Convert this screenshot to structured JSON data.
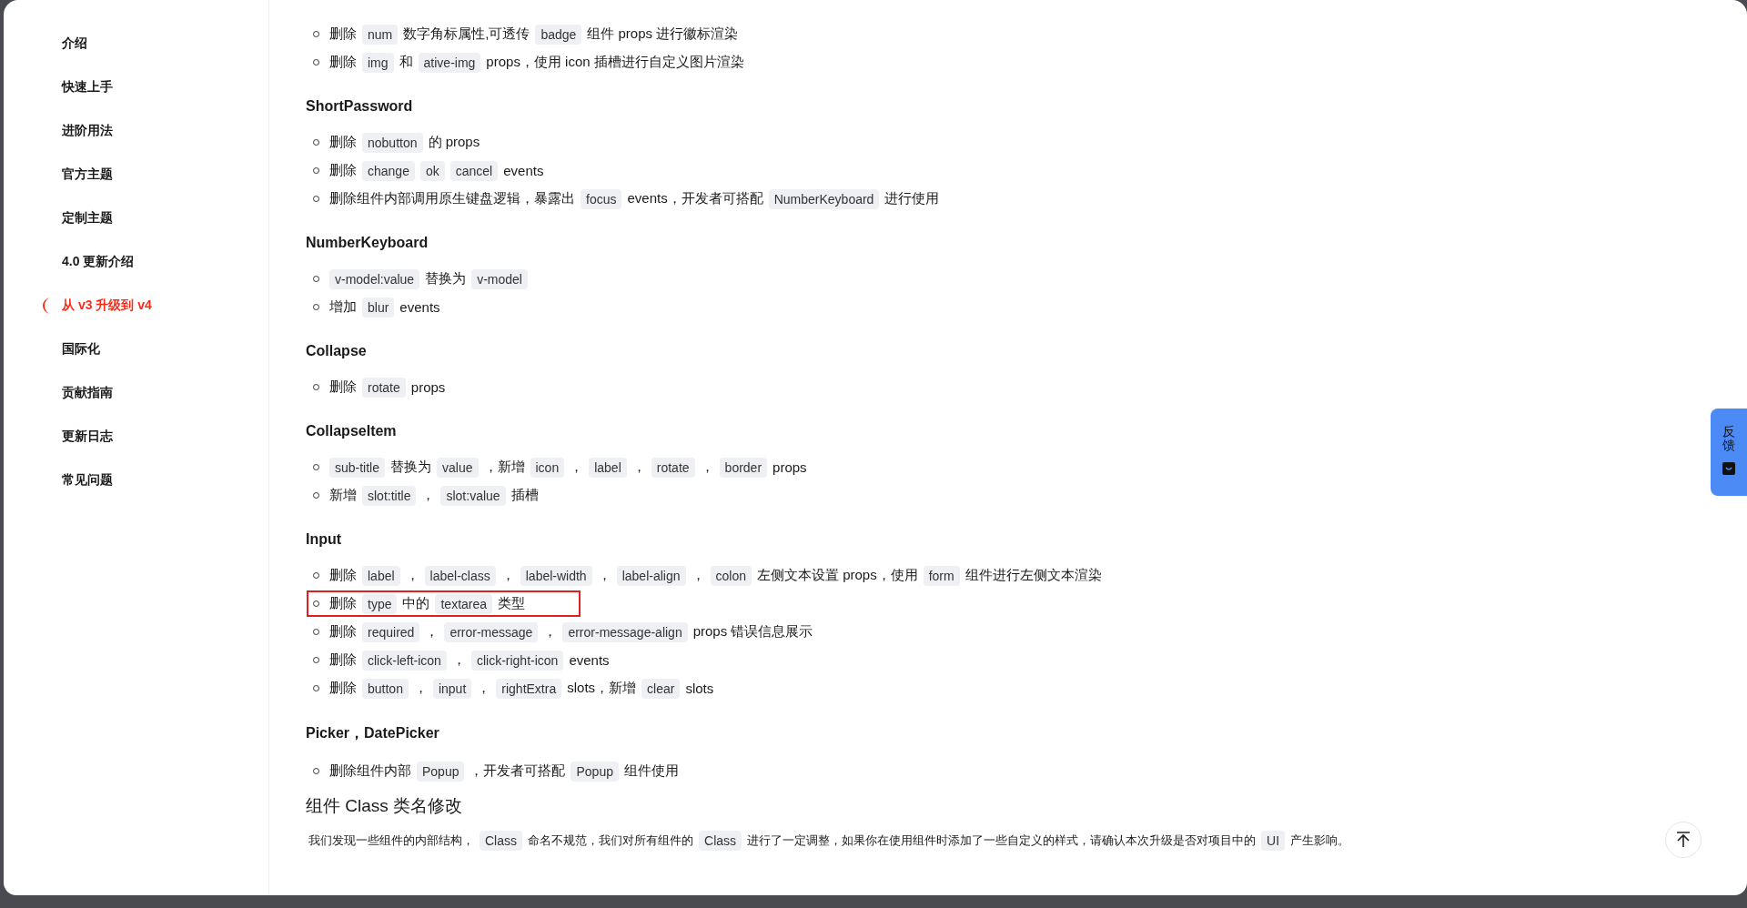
{
  "sidebar": {
    "items": [
      {
        "label": "介绍",
        "selected": false
      },
      {
        "label": "快速上手",
        "selected": false
      },
      {
        "label": "进阶用法",
        "selected": false
      },
      {
        "label": "官方主题",
        "selected": false
      },
      {
        "label": "定制主题",
        "selected": false
      },
      {
        "label": "4.0 更新介绍",
        "selected": false
      },
      {
        "label": "从 v3 升级到 v4",
        "selected": true
      },
      {
        "label": "国际化",
        "selected": false
      },
      {
        "label": "贡献指南",
        "selected": false
      },
      {
        "label": "更新日志",
        "selected": false
      },
      {
        "label": "常见问题",
        "selected": false
      }
    ]
  },
  "content": {
    "blocks": [
      {
        "kind": "list",
        "items": [
          {
            "highlighted": false,
            "segments": [
              {
                "kind": "text",
                "text": "删除"
              },
              {
                "kind": "code",
                "text": "num"
              },
              {
                "kind": "text",
                "text": "数字角标属性,可透传"
              },
              {
                "kind": "code",
                "text": "badge"
              },
              {
                "kind": "text",
                "text": "组件 props 进行徽标渲染"
              }
            ]
          },
          {
            "highlighted": false,
            "segments": [
              {
                "kind": "text",
                "text": "删除"
              },
              {
                "kind": "code",
                "text": "img"
              },
              {
                "kind": "text",
                "text": "和"
              },
              {
                "kind": "code",
                "text": "ative-img"
              },
              {
                "kind": "text",
                "text": "props，使用 icon 插槽进行自定义图片渲染"
              }
            ]
          }
        ]
      },
      {
        "kind": "heading",
        "text": "ShortPassword"
      },
      {
        "kind": "list",
        "items": [
          {
            "highlighted": false,
            "segments": [
              {
                "kind": "text",
                "text": "删除"
              },
              {
                "kind": "code",
                "text": "nobutton"
              },
              {
                "kind": "text",
                "text": "的 props"
              }
            ]
          },
          {
            "highlighted": false,
            "segments": [
              {
                "kind": "text",
                "text": "删除"
              },
              {
                "kind": "code",
                "text": "change"
              },
              {
                "kind": "code",
                "text": "ok"
              },
              {
                "kind": "code",
                "text": "cancel"
              },
              {
                "kind": "text",
                "text": "events"
              }
            ]
          },
          {
            "highlighted": false,
            "segments": [
              {
                "kind": "text",
                "text": "删除组件内部调用原生键盘逻辑，暴露出"
              },
              {
                "kind": "code",
                "text": "focus"
              },
              {
                "kind": "text",
                "text": "events，开发者可搭配"
              },
              {
                "kind": "code",
                "text": "NumberKeyboard"
              },
              {
                "kind": "text",
                "text": "进行使用"
              }
            ]
          }
        ]
      },
      {
        "kind": "heading",
        "text": "NumberKeyboard"
      },
      {
        "kind": "list",
        "items": [
          {
            "highlighted": false,
            "segments": [
              {
                "kind": "code",
                "text": "v-model:value"
              },
              {
                "kind": "text",
                "text": "替换为"
              },
              {
                "kind": "code",
                "text": "v-model"
              }
            ]
          },
          {
            "highlighted": false,
            "segments": [
              {
                "kind": "text",
                "text": "增加"
              },
              {
                "kind": "code",
                "text": "blur"
              },
              {
                "kind": "text",
                "text": "events"
              }
            ]
          }
        ]
      },
      {
        "kind": "heading",
        "text": "Collapse"
      },
      {
        "kind": "list",
        "items": [
          {
            "highlighted": false,
            "segments": [
              {
                "kind": "text",
                "text": "删除"
              },
              {
                "kind": "code",
                "text": "rotate"
              },
              {
                "kind": "text",
                "text": "props"
              }
            ]
          }
        ]
      },
      {
        "kind": "heading",
        "text": "CollapseItem"
      },
      {
        "kind": "list",
        "items": [
          {
            "highlighted": false,
            "segments": [
              {
                "kind": "code",
                "text": "sub-title"
              },
              {
                "kind": "text",
                "text": "替换为"
              },
              {
                "kind": "code",
                "text": "value"
              },
              {
                "kind": "text",
                "text": "，新增"
              },
              {
                "kind": "code",
                "text": "icon"
              },
              {
                "kind": "text",
                "text": "，"
              },
              {
                "kind": "code",
                "text": "label"
              },
              {
                "kind": "text",
                "text": "，"
              },
              {
                "kind": "code",
                "text": "rotate"
              },
              {
                "kind": "text",
                "text": "，"
              },
              {
                "kind": "code",
                "text": "border"
              },
              {
                "kind": "text",
                "text": "props"
              }
            ]
          },
          {
            "highlighted": false,
            "segments": [
              {
                "kind": "text",
                "text": "新增"
              },
              {
                "kind": "code",
                "text": "slot:title"
              },
              {
                "kind": "text",
                "text": "，"
              },
              {
                "kind": "code",
                "text": "slot:value"
              },
              {
                "kind": "text",
                "text": "插槽"
              }
            ]
          }
        ]
      },
      {
        "kind": "heading",
        "text": "Input"
      },
      {
        "kind": "list",
        "items": [
          {
            "highlighted": false,
            "segments": [
              {
                "kind": "text",
                "text": "删除"
              },
              {
                "kind": "code",
                "text": "label"
              },
              {
                "kind": "text",
                "text": "，"
              },
              {
                "kind": "code",
                "text": "label-class"
              },
              {
                "kind": "text",
                "text": "，"
              },
              {
                "kind": "code",
                "text": "label-width"
              },
              {
                "kind": "text",
                "text": "，"
              },
              {
                "kind": "code",
                "text": "label-align"
              },
              {
                "kind": "text",
                "text": "，"
              },
              {
                "kind": "code",
                "text": "colon"
              },
              {
                "kind": "text",
                "text": "左侧文本设置 props，使用"
              },
              {
                "kind": "code",
                "text": "form"
              },
              {
                "kind": "text",
                "text": "组件进行左侧文本渲染"
              }
            ]
          },
          {
            "highlighted": true,
            "segments": [
              {
                "kind": "text",
                "text": "删除"
              },
              {
                "kind": "code",
                "text": "type"
              },
              {
                "kind": "text",
                "text": "中的"
              },
              {
                "kind": "code",
                "text": "textarea"
              },
              {
                "kind": "text",
                "text": "类型"
              }
            ]
          },
          {
            "highlighted": false,
            "segments": [
              {
                "kind": "text",
                "text": "删除"
              },
              {
                "kind": "code",
                "text": "required"
              },
              {
                "kind": "text",
                "text": "，"
              },
              {
                "kind": "code",
                "text": "error-message"
              },
              {
                "kind": "text",
                "text": "，"
              },
              {
                "kind": "code",
                "text": "error-message-align"
              },
              {
                "kind": "text",
                "text": "props 错误信息展示"
              }
            ]
          },
          {
            "highlighted": false,
            "segments": [
              {
                "kind": "text",
                "text": "删除"
              },
              {
                "kind": "code",
                "text": "click-left-icon"
              },
              {
                "kind": "text",
                "text": "，"
              },
              {
                "kind": "code",
                "text": "click-right-icon"
              },
              {
                "kind": "text",
                "text": "events"
              }
            ]
          },
          {
            "highlighted": false,
            "segments": [
              {
                "kind": "text",
                "text": "删除"
              },
              {
                "kind": "code",
                "text": "button"
              },
              {
                "kind": "text",
                "text": "，"
              },
              {
                "kind": "code",
                "text": "input"
              },
              {
                "kind": "text",
                "text": "，"
              },
              {
                "kind": "code",
                "text": "rightExtra"
              },
              {
                "kind": "text",
                "text": "slots，新增"
              },
              {
                "kind": "code",
                "text": "clear"
              },
              {
                "kind": "text",
                "text": "slots"
              }
            ]
          }
        ]
      },
      {
        "kind": "heading",
        "text": "Picker，DatePicker"
      },
      {
        "kind": "list",
        "items": [
          {
            "highlighted": false,
            "segments": [
              {
                "kind": "text",
                "text": "删除组件内部"
              },
              {
                "kind": "code",
                "text": "Popup"
              },
              {
                "kind": "text",
                "text": "，开发者可搭配"
              },
              {
                "kind": "code",
                "text": "Popup"
              },
              {
                "kind": "text",
                "text": "组件使用"
              }
            ]
          }
        ]
      },
      {
        "kind": "section_heading",
        "text": "组件 Class 类名修改"
      },
      {
        "kind": "paragraph",
        "segments": [
          {
            "kind": "text",
            "text": "我们发现一些组件的内部结构，"
          },
          {
            "kind": "code",
            "text": "Class"
          },
          {
            "kind": "text",
            "text": "命名不规范，我们对所有组件的"
          },
          {
            "kind": "code",
            "text": "Class"
          },
          {
            "kind": "text",
            "text": "进行了一定调整，如果你在使用组件时添加了一些自定义的样式，请确认本次升级是否对项目中的"
          },
          {
            "kind": "code",
            "text": "UI"
          },
          {
            "kind": "text",
            "text": "产生影响。"
          }
        ]
      }
    ]
  },
  "feedback_tab": {
    "label": "反馈"
  }
}
